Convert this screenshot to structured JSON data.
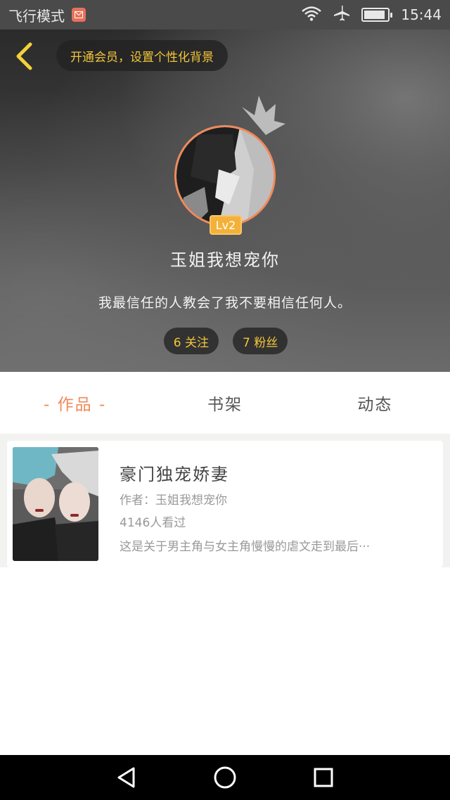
{
  "status_bar": {
    "mode": "飞行模式",
    "time": "15:44",
    "icons": [
      "mail-icon",
      "wifi-icon",
      "airplane-icon",
      "battery-icon"
    ],
    "battery_level": 0.9
  },
  "header": {
    "vip_prompt": "开通会员，设置个性化背景",
    "level": "Lv2",
    "username": "玉姐我想宠你",
    "signature": "我最信任的人教会了我不要相信任何人。",
    "following": "6 关注",
    "followers": "7 粉丝"
  },
  "tabs": [
    {
      "label": "- 作品 -",
      "active": true
    },
    {
      "label": "书架",
      "active": false
    },
    {
      "label": "动态",
      "active": false
    }
  ],
  "books": [
    {
      "title": "豪门独宠娇妻",
      "author": "作者：玉姐我想宠你",
      "views": "4146人看过",
      "description": "这是关于男主角与女主角慢慢的虐文走到最后···"
    }
  ],
  "colors": {
    "accent": "#f08a5a",
    "gold": "#f3c53a",
    "level_badge": "#f4b13a"
  },
  "nav_bar": [
    "back-icon",
    "home-icon",
    "recents-icon"
  ]
}
